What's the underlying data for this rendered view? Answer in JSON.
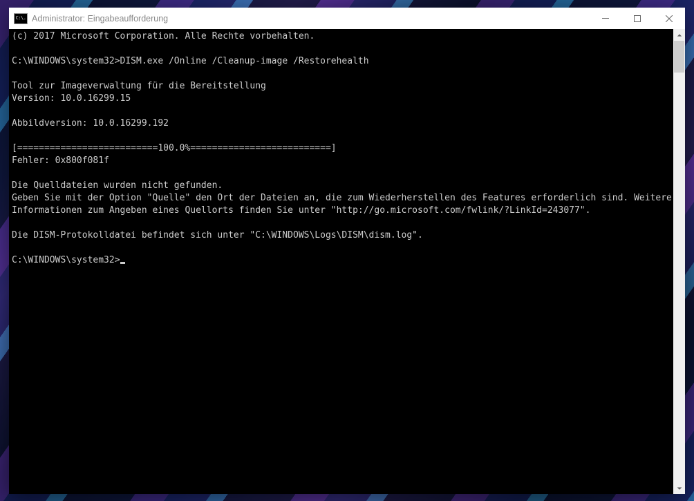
{
  "window": {
    "title": "Administrator: Eingabeaufforderung",
    "icon_label": "C:\\."
  },
  "console": {
    "lines": [
      "(c) 2017 Microsoft Corporation. Alle Rechte vorbehalten.",
      "",
      "C:\\WINDOWS\\system32>DISM.exe /Online /Cleanup-image /Restorehealth",
      "",
      "Tool zur Imageverwaltung für die Bereitstellung",
      "Version: 10.0.16299.15",
      "",
      "Abbildversion: 10.0.16299.192",
      "",
      "[==========================100.0%==========================]",
      "Fehler: 0x800f081f",
      "",
      "Die Quelldateien wurden nicht gefunden.",
      "Geben Sie mit der Option \"Quelle\" den Ort der Dateien an, die zum Wiederherstellen des Features erforderlich sind. Weitere Informationen zum Angeben eines Quellorts finden Sie unter \"http://go.microsoft.com/fwlink/?LinkId=243077\".",
      "",
      "Die DISM-Protokolldatei befindet sich unter \"C:\\WINDOWS\\Logs\\DISM\\dism.log\".",
      ""
    ],
    "prompt": "C:\\WINDOWS\\system32>"
  }
}
